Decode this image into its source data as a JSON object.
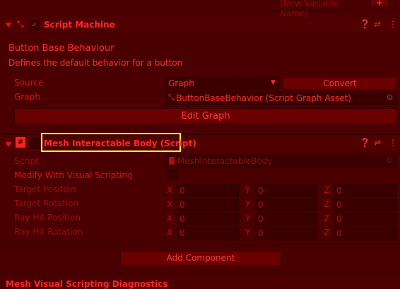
{
  "top": {
    "new_variable_placeholder": "(New Variable Name)",
    "add_label": "+"
  },
  "script_machine": {
    "title": "Script Machine",
    "graph_title": "Button Base Behaviour",
    "graph_summary": "Defines the default behavior for a button",
    "source_label": "Source",
    "source_value": "Graph",
    "convert_label": "Convert",
    "graph_label": "Graph",
    "graph_value": "ButtonBaseBehavior (Script Graph Asset)",
    "edit_graph_label": "Edit Graph"
  },
  "mesh_body": {
    "title": "Mesh Interactable Body (Script)",
    "script_label": "Script",
    "script_value": "MeshInteractableBody",
    "modify_label": "Modify With Visual Scripting",
    "rows": [
      {
        "label": "Target Position",
        "x": "0",
        "y": "0",
        "z": "0"
      },
      {
        "label": "Target Rotation",
        "x": "0",
        "y": "0",
        "z": "0"
      },
      {
        "label": "Ray Hit Position",
        "x": "0",
        "y": "0",
        "z": "0"
      },
      {
        "label": "Ray Hit Rotation",
        "x": "0",
        "y": "0",
        "z": "0"
      }
    ],
    "axis": {
      "x": "X",
      "y": "Y",
      "z": "Z"
    }
  },
  "add_component_label": "Add Component",
  "diagnostics_title": "Mesh Visual Scripting Diagnostics",
  "colors": {
    "background": "#4a0000",
    "highlight": "#ffff33"
  }
}
